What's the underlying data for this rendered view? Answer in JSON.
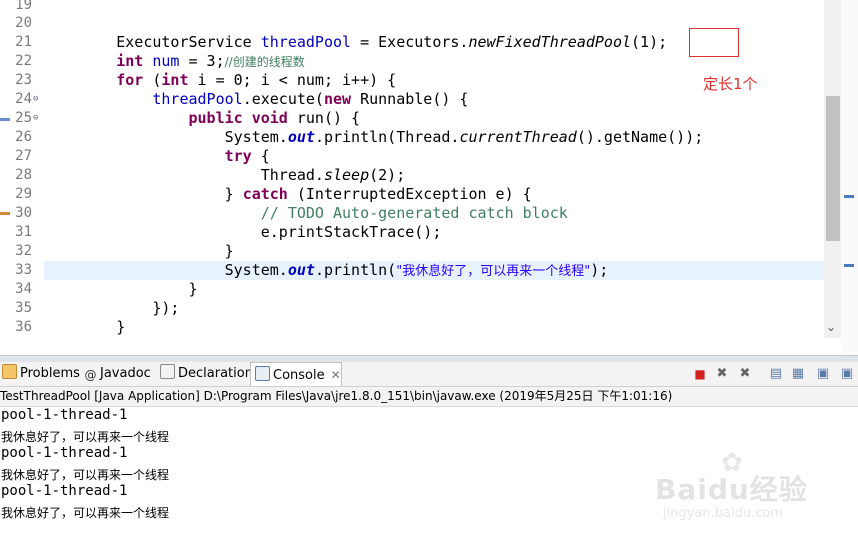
{
  "editor": {
    "line_numbers": [
      "19",
      "20",
      "21",
      "22",
      "23",
      "24",
      "25",
      "26",
      "27",
      "28",
      "29",
      "30",
      "31",
      "32",
      "33",
      "34",
      "35",
      "36"
    ],
    "annotation": "定长1个",
    "code": {
      "l21": {
        "a": "ExecutorService ",
        "b": "threadPool",
        "c": " = Executors.",
        "d": "newFixedThreadPool",
        "e": "(1);"
      },
      "l22": {
        "kw": "int",
        "b": " num",
        "c": " = 3;",
        "cm": "//创建的线程数"
      },
      "l23": {
        "kw": "for",
        "b": " (",
        "kw2": "int",
        "c": " i = 0; i < num; i++) {"
      },
      "l24": {
        "a": "threadPool",
        "b": ".execute(",
        "kw": "new",
        "c": " Runnable() {"
      },
      "l25": {
        "kw": "public",
        "kw2": "void",
        "c": " run() {"
      },
      "l26": {
        "a": "System.",
        "b": "out",
        "c": ".println(Thread.",
        "d": "currentThread",
        "e": "().getName());"
      },
      "l27": {
        "kw": "try",
        "c": " {"
      },
      "l28": {
        "a": "Thread.",
        "b": "sleep",
        "c": "(2);"
      },
      "l29": {
        "a": "} ",
        "kw": "catch",
        "c": " (InterruptedException e) {"
      },
      "l30": {
        "cm": "// TODO Auto-generated catch block"
      },
      "l31": {
        "a": "e.printStackTrace();"
      },
      "l32": {
        "a": "}"
      },
      "l33": {
        "a": "System.",
        "b": "out",
        "c": ".println(",
        "s": "\"我休息好了，可以再来一个线程\"",
        "e": ");"
      },
      "l34": {
        "a": "}"
      },
      "l35": {
        "a": "});"
      },
      "l36": {
        "a": "}"
      }
    }
  },
  "views": {
    "tabs": [
      {
        "label": "Problems",
        "icon": "problems-icon"
      },
      {
        "label": "Javadoc",
        "icon": "javadoc-icon"
      },
      {
        "label": "Declaration",
        "icon": "declaration-icon"
      },
      {
        "label": "Console",
        "icon": "console-icon",
        "active": true
      }
    ],
    "toolbar": [
      "terminate-icon",
      "remove-launch-icon",
      "remove-all-icon",
      "scroll-lock-icon",
      "pin-console-icon",
      "display-console-icon",
      "open-console-icon"
    ]
  },
  "console": {
    "launch_info": "TestThreadPool [Java Application] D:\\Program Files\\Java\\jre1.8.0_151\\bin\\javaw.exe (2019年5月25日 下午1:01:16)",
    "lines": [
      "pool-1-thread-1",
      "我休息好了，可以再来一个线程",
      "pool-1-thread-1",
      "我休息好了，可以再来一个线程",
      "pool-1-thread-1",
      "我休息好了，可以再来一个线程"
    ]
  },
  "watermark": {
    "main": "Baidu经验",
    "sub": "jingyan.baidu.com"
  },
  "colors": {
    "keyword": "#7f0055",
    "field": "#0000c0",
    "comment": "#3f7f5f",
    "string": "#2a00ff",
    "annotation": "#e03030",
    "highlight": "#e8f2fe"
  }
}
